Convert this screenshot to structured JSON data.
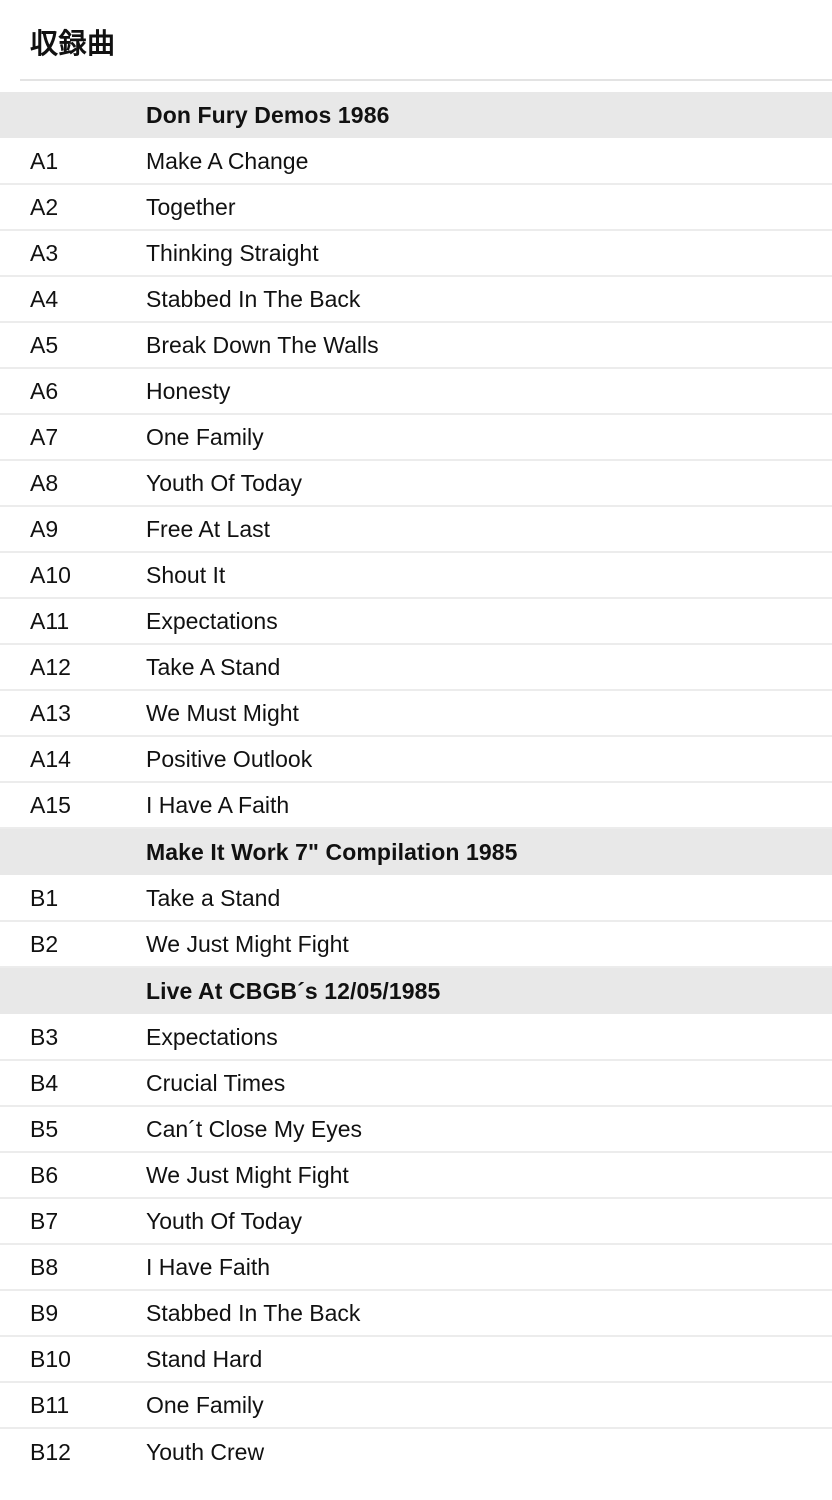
{
  "page": {
    "title": "収録曲"
  },
  "tracklist": {
    "columns": [
      "position",
      "title"
    ],
    "rows": [
      {
        "kind": "section",
        "heading": "Don Fury Demos 1986"
      },
      {
        "kind": "track",
        "position": "A1",
        "title": "Make A Change"
      },
      {
        "kind": "track",
        "position": "A2",
        "title": "Together"
      },
      {
        "kind": "track",
        "position": "A3",
        "title": "Thinking Straight"
      },
      {
        "kind": "track",
        "position": "A4",
        "title": "Stabbed In The Back"
      },
      {
        "kind": "track",
        "position": "A5",
        "title": "Break Down The Walls"
      },
      {
        "kind": "track",
        "position": "A6",
        "title": "Honesty"
      },
      {
        "kind": "track",
        "position": "A7",
        "title": "One Family"
      },
      {
        "kind": "track",
        "position": "A8",
        "title": "Youth Of Today"
      },
      {
        "kind": "track",
        "position": "A9",
        "title": "Free At Last"
      },
      {
        "kind": "track",
        "position": "A10",
        "title": "Shout It"
      },
      {
        "kind": "track",
        "position": "A11",
        "title": "Expectations"
      },
      {
        "kind": "track",
        "position": "A12",
        "title": "Take A Stand"
      },
      {
        "kind": "track",
        "position": "A13",
        "title": "We Must Might"
      },
      {
        "kind": "track",
        "position": "A14",
        "title": "Positive Outlook"
      },
      {
        "kind": "track",
        "position": "A15",
        "title": "I Have A Faith"
      },
      {
        "kind": "section",
        "heading": "Make It Work 7\" Compilation 1985"
      },
      {
        "kind": "track",
        "position": "B1",
        "title": "Take a Stand"
      },
      {
        "kind": "track",
        "position": "B2",
        "title": "We Just Might Fight"
      },
      {
        "kind": "section",
        "heading": "Live At CBGB´s 12/05/1985"
      },
      {
        "kind": "track",
        "position": "B3",
        "title": "Expectations"
      },
      {
        "kind": "track",
        "position": "B4",
        "title": "Crucial Times"
      },
      {
        "kind": "track",
        "position": "B5",
        "title": "Can´t Close My Eyes"
      },
      {
        "kind": "track",
        "position": "B6",
        "title": "We Just Might Fight"
      },
      {
        "kind": "track",
        "position": "B7",
        "title": "Youth Of Today"
      },
      {
        "kind": "track",
        "position": "B8",
        "title": "I Have Faith"
      },
      {
        "kind": "track",
        "position": "B9",
        "title": "Stabbed In The Back"
      },
      {
        "kind": "track",
        "position": "B10",
        "title": "Stand Hard"
      },
      {
        "kind": "track",
        "position": "B11",
        "title": "One Family"
      },
      {
        "kind": "track",
        "position": "B12",
        "title": "Youth Crew"
      }
    ]
  },
  "colors": {
    "section_band": "#e8e8e8",
    "row_divider": "#ececec",
    "title_rule": "#e3e3e3",
    "text": "#111111",
    "background": "#ffffff"
  }
}
